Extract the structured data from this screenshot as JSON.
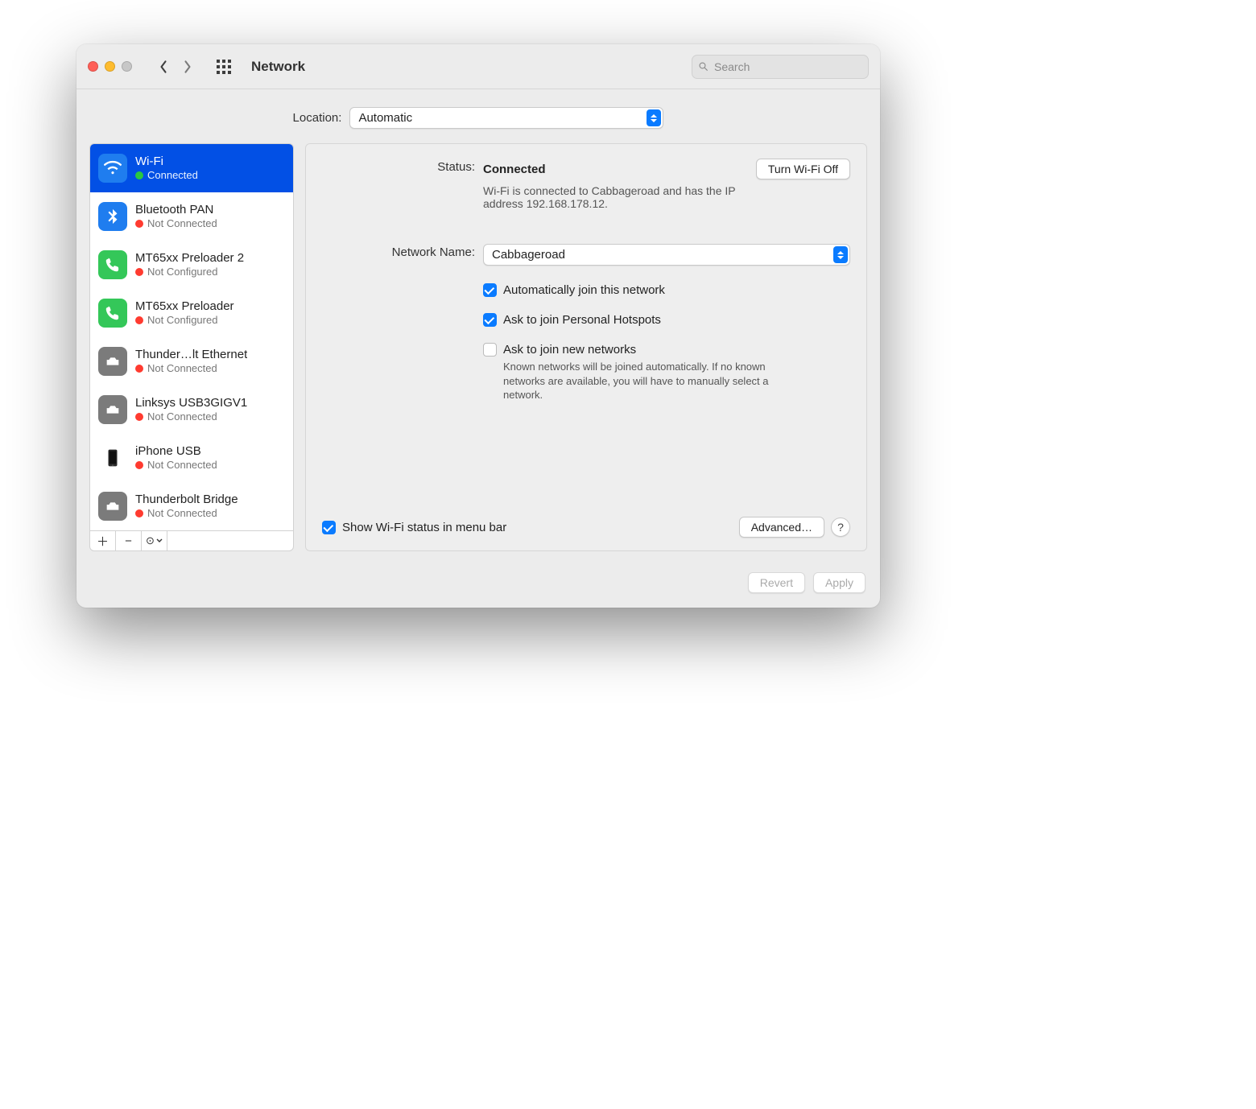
{
  "title": "Network",
  "search": {
    "placeholder": "Search"
  },
  "location": {
    "label": "Location:",
    "value": "Automatic"
  },
  "sidebar": {
    "items": [
      {
        "name": "Wi-Fi",
        "status": "Connected",
        "dot": "green",
        "icon": "wifi",
        "iconColor": "#1f7def",
        "selected": true
      },
      {
        "name": "Bluetooth PAN",
        "status": "Not Connected",
        "dot": "red",
        "icon": "bluetooth",
        "iconColor": "#1f7def"
      },
      {
        "name": "MT65xx Preloader 2",
        "status": "Not Configured",
        "dot": "red",
        "icon": "phone",
        "iconColor": "#34c759"
      },
      {
        "name": "MT65xx Preloader",
        "status": "Not Configured",
        "dot": "red",
        "icon": "phone",
        "iconColor": "#34c759"
      },
      {
        "name": "Thunder…lt Ethernet",
        "status": "Not Connected",
        "dot": "red",
        "icon": "ethernet",
        "iconColor": "#7b7b7b"
      },
      {
        "name": "Linksys USB3GIGV1",
        "status": "Not Connected",
        "dot": "red",
        "icon": "ethernet",
        "iconColor": "#7b7b7b"
      },
      {
        "name": "iPhone USB",
        "status": "Not Connected",
        "dot": "red",
        "icon": "iphone",
        "iconColor": "#333333"
      },
      {
        "name": "Thunderbolt Bridge",
        "status": "Not Connected",
        "dot": "red",
        "icon": "ethernet",
        "iconColor": "#7b7b7b"
      }
    ]
  },
  "detail": {
    "status_label": "Status:",
    "status_value": "Connected",
    "turn_off": "Turn Wi-Fi Off",
    "status_desc": "Wi-Fi is connected to Cabbageroad and has the IP address 192.168.178.12.",
    "netname_label": "Network Name:",
    "netname_value": "Cabbageroad",
    "auto_join": "Automatically join this network",
    "ask_hotspot": "Ask to join Personal Hotspots",
    "ask_new": "Ask to join new networks",
    "ask_new_help": "Known networks will be joined automatically. If no known networks are available, you will have to manually select a network.",
    "show_menubar": "Show Wi-Fi status in menu bar",
    "advanced": "Advanced…",
    "help": "?"
  },
  "footer": {
    "revert": "Revert",
    "apply": "Apply"
  }
}
